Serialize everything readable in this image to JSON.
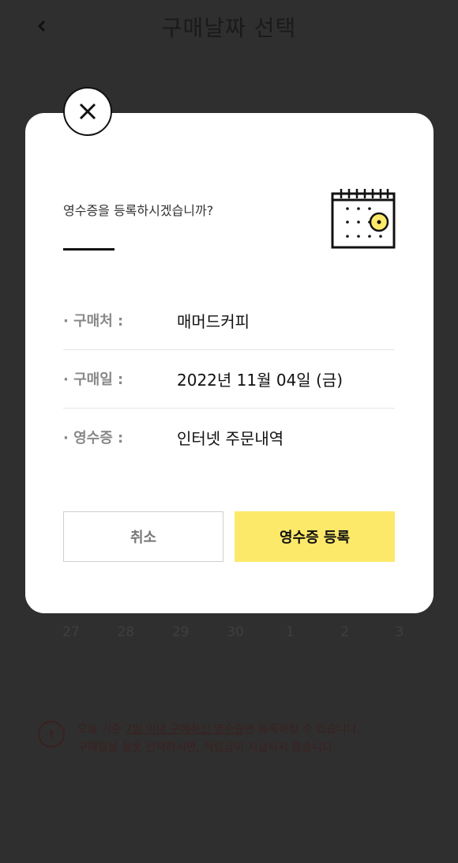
{
  "header": {
    "title": "구매날짜 선택",
    "back_icon": "chevron-left-icon"
  },
  "calendar": {
    "last_row": [
      "27",
      "28",
      "29",
      "30",
      "1",
      "2",
      "3"
    ]
  },
  "notice": {
    "part1": "오늘 기준 ",
    "part2": "7일 이내 구매하신 영수증",
    "part3": "만 등록하실 수 있습니다.",
    "line2": "구매일을 잘못 선택하시면, 적립금이 지급되지 않습니다."
  },
  "modal": {
    "question": "영수증을 등록하시겠습니까?",
    "rows": [
      {
        "label": "· 구매처 :",
        "value": "매머드커피"
      },
      {
        "label": "· 구매일 :",
        "value": "2022년 11월 04일 (금)"
      },
      {
        "label": "· 영수증 :",
        "value": "인터넷 주문내역"
      }
    ],
    "cancel_label": "취소",
    "confirm_label": "영수증 등록"
  },
  "colors": {
    "accent": "#fce96a",
    "overlay_bg": "#2f2f2f",
    "modal_bg": "#ffffff"
  }
}
